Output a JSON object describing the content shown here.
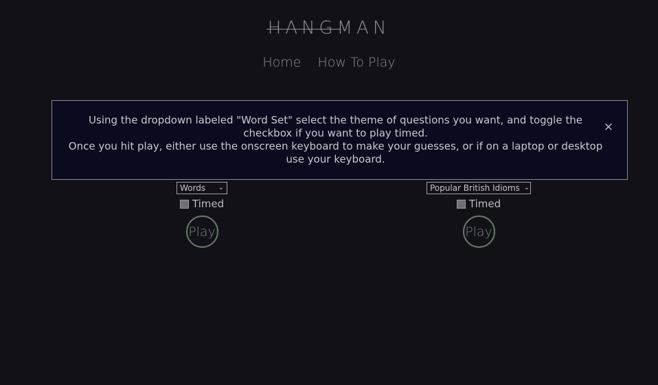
{
  "header": {
    "title_struck": "HANG",
    "title_rest": "MAN"
  },
  "nav": {
    "home": "Home",
    "how_to_play": "How To Play"
  },
  "banner": {
    "line1": "Using the dropdown labeled \"Word Set\" select the theme of questions you want, and toggle the checkbox if you want to play timed.",
    "line2": "Once you hit play, either use the onscreen keyboard to make your guesses, or if on a laptop or desktop use your keyboard.",
    "close": "×"
  },
  "game_left": {
    "word_set_selected": "Words",
    "timed_label": "Timed",
    "timed_checked": false,
    "play_label": "Play"
  },
  "game_right": {
    "word_set_selected": "Popular British Idioms",
    "timed_label": "Timed",
    "timed_checked": false,
    "play_label": "Play"
  },
  "icons": {
    "close": "close-icon",
    "dropdown": "chevron-down-icon"
  },
  "colors": {
    "background": "#121118",
    "banner_background": "#0b0b1f",
    "play_accent": "#6b7a6b"
  }
}
